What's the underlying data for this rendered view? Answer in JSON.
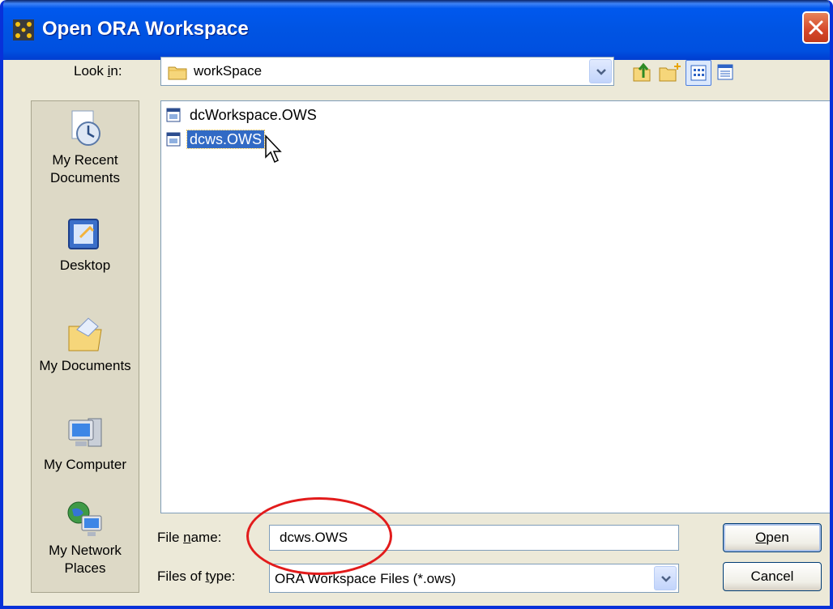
{
  "window": {
    "title": "Open ORA Workspace"
  },
  "lookin": {
    "label_prefix": "Look ",
    "label_mnemonic": "i",
    "label_suffix": "n:",
    "value": "workSpace"
  },
  "toolbar": {
    "up_icon": "up-one-level-icon",
    "newfolder_icon": "new-folder-icon",
    "list_icon": "list-view-icon",
    "details_icon": "details-view-icon"
  },
  "places": [
    {
      "label_line1": "My Recent",
      "label_line2": "Documents",
      "icon": "recent-documents-icon"
    },
    {
      "label_line1": "Desktop",
      "label_line2": "",
      "icon": "desktop-icon"
    },
    {
      "label_line1": "My Documents",
      "label_line2": "",
      "icon": "my-documents-icon"
    },
    {
      "label_line1": "My Computer",
      "label_line2": "",
      "icon": "my-computer-icon"
    },
    {
      "label_line1": "My Network",
      "label_line2": "Places",
      "icon": "network-places-icon"
    }
  ],
  "files": [
    {
      "name": "dcWorkspace.OWS",
      "selected": false
    },
    {
      "name": "dcws.OWS",
      "selected": true
    }
  ],
  "filename": {
    "label_prefix": "File ",
    "label_mnemonic": "n",
    "label_suffix": "ame:",
    "value": "dcws.OWS"
  },
  "filetype": {
    "label_prefix": "Files of ",
    "label_mnemonic": "t",
    "label_suffix": "ype:",
    "value": "ORA Workspace Files (*.ows)"
  },
  "buttons": {
    "open_mnemonic": "O",
    "open_rest": "pen",
    "cancel": "Cancel"
  },
  "colors": {
    "accent": "#0054e3",
    "selection": "#316ac5",
    "highlight_circle": "#e21b1b"
  }
}
